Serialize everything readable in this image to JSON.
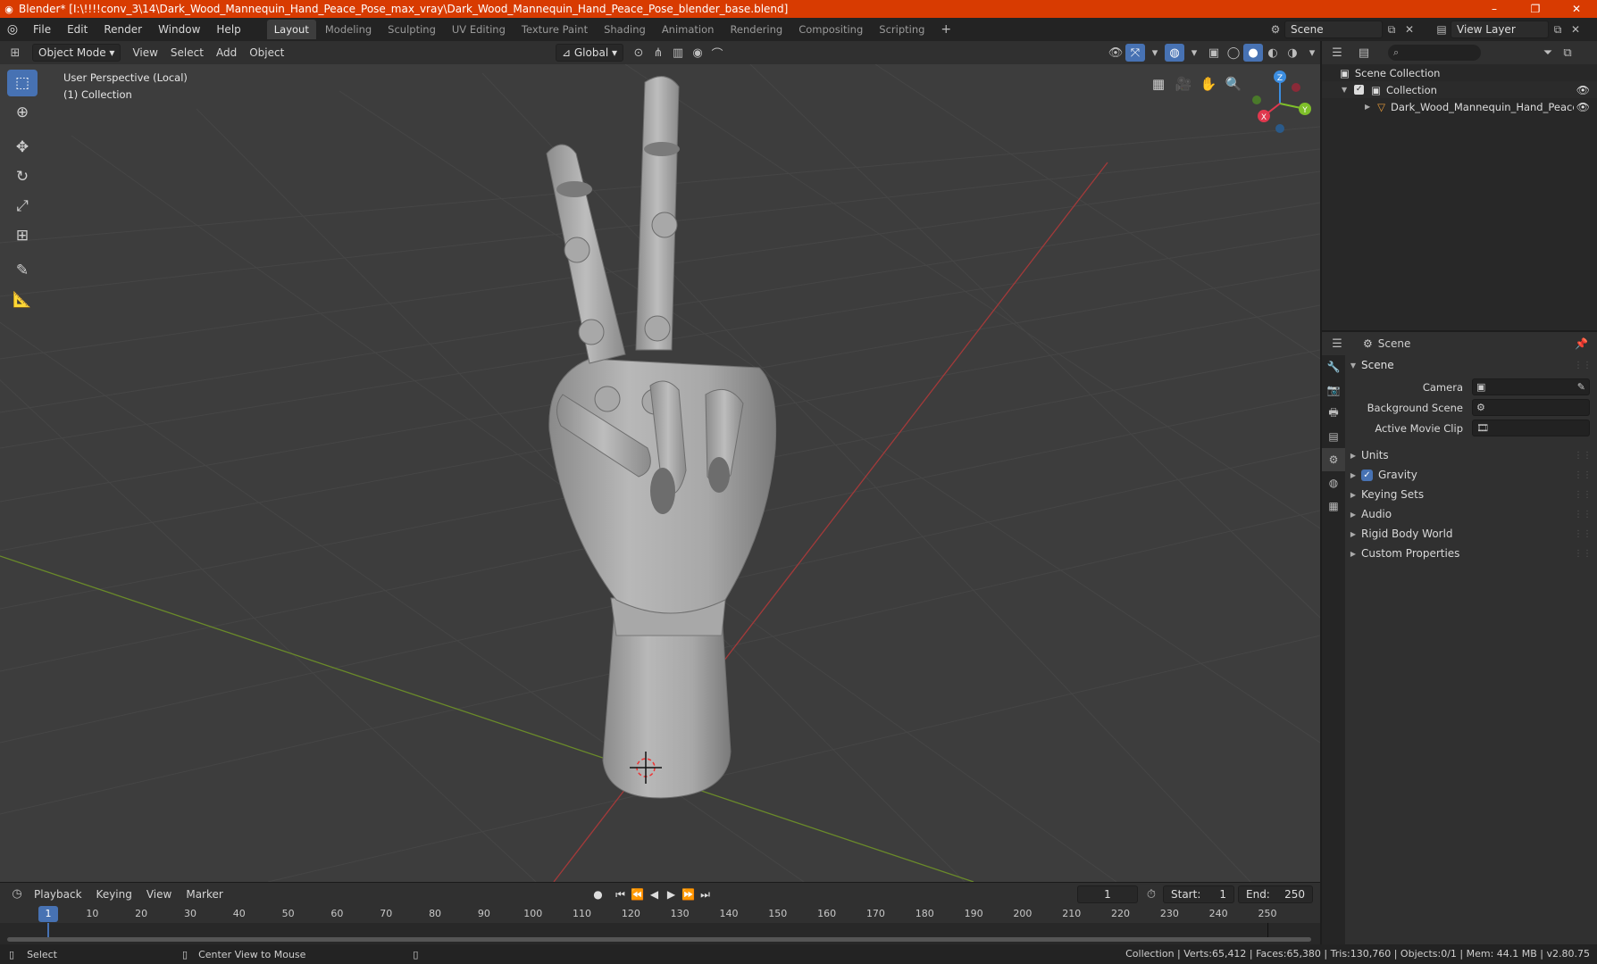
{
  "titlebar": {
    "title": "Blender* [I:\\!!!!conv_3\\14\\Dark_Wood_Mannequin_Hand_Peace_Pose_max_vray\\Dark_Wood_Mannequin_Hand_Peace_Pose_blender_base.blend]",
    "minimize": "–",
    "restore": "❐",
    "close": "✕"
  },
  "menu": {
    "file": "File",
    "edit": "Edit",
    "render": "Render",
    "window": "Window",
    "help": "Help"
  },
  "workspaces": [
    "Layout",
    "Modeling",
    "Sculpting",
    "UV Editing",
    "Texture Paint",
    "Shading",
    "Animation",
    "Rendering",
    "Compositing",
    "Scripting"
  ],
  "workspace_add": "+",
  "scene_selector": {
    "value": "Scene"
  },
  "view_layer_selector": {
    "value": "View Layer"
  },
  "viewport_header": {
    "mode": "Object Mode",
    "view": "View",
    "select": "Select",
    "add": "Add",
    "object": "Object",
    "orientation": "Global"
  },
  "viewport": {
    "perspective_label": "User Perspective (Local)",
    "collection_label": "(1) Collection",
    "gizmo": {
      "x": "X",
      "y": "Y",
      "z": "Z"
    }
  },
  "timeline": {
    "playback": "Playback",
    "keying": "Keying",
    "view": "View",
    "marker": "Marker",
    "current_frame": "1",
    "start_label": "Start:",
    "start_value": "1",
    "end_label": "End:",
    "end_value": "250",
    "ruler": [
      "10",
      "20",
      "30",
      "40",
      "50",
      "60",
      "70",
      "80",
      "90",
      "100",
      "110",
      "120",
      "130",
      "140",
      "150",
      "160",
      "170",
      "180",
      "190",
      "200",
      "210",
      "220",
      "230",
      "240",
      "250"
    ],
    "ruler_current": "1"
  },
  "statusbar": {
    "select": "Select",
    "center_view": "Center View to Mouse",
    "stats": "Collection | Verts:65,412 | Faces:65,380 | Tris:130,760 | Objects:0/1 | Mem: 44.1 MB | v2.80.75"
  },
  "outliner": {
    "scene_collection": "Scene Collection",
    "collection": "Collection",
    "object": "Dark_Wood_Mannequin_Hand_Peace_Pose_r"
  },
  "properties": {
    "context_label": "Scene",
    "panel_title": "Scene",
    "camera_label": "Camera",
    "background_scene_label": "Background Scene",
    "active_movie_clip_label": "Active Movie Clip",
    "sections": [
      "Units",
      "Gravity",
      "Keying Sets",
      "Audio",
      "Rigid Body World",
      "Custom Properties"
    ],
    "gravity_checked": "✓"
  }
}
